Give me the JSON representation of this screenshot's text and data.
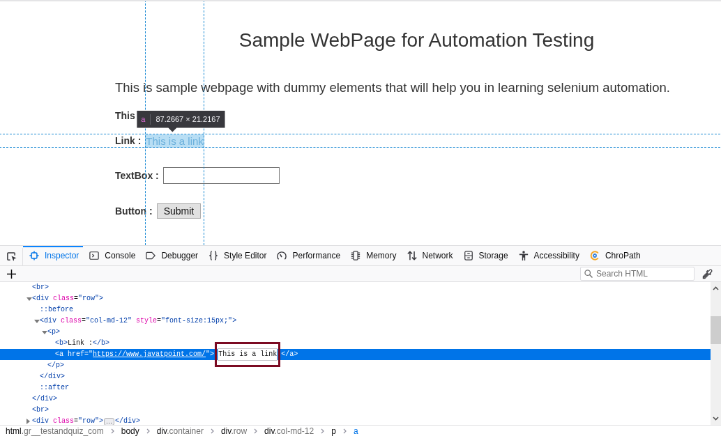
{
  "page": {
    "title": "Sample WebPage for Automation Testing",
    "intro": "This is sample webpage with dummy elements that will help you in learning selenium automation.",
    "rows": [
      {
        "kind": "text",
        "label": "This"
      },
      {
        "kind": "link",
        "label": "Link :",
        "link": "This is a link",
        "highlighted": true,
        "infobar": {
          "tag": "a",
          "size": "87.2667 × 21.2167"
        }
      },
      {
        "kind": "textbox",
        "label": "TextBox :"
      },
      {
        "kind": "button",
        "label": "Button :",
        "button": "Submit"
      }
    ]
  },
  "devtools": {
    "tabs": [
      {
        "label": "Inspector",
        "selected": true
      },
      {
        "label": "Console",
        "selected": false
      },
      {
        "label": "Debugger",
        "selected": false
      },
      {
        "label": "Style Editor",
        "selected": false
      },
      {
        "label": "Performance",
        "selected": false
      },
      {
        "label": "Memory",
        "selected": false
      },
      {
        "label": "Network",
        "selected": false
      },
      {
        "label": "Storage",
        "selected": false
      },
      {
        "label": "Accessibility",
        "selected": false
      },
      {
        "label": "ChroPath",
        "selected": false
      }
    ],
    "search": {
      "placeholder": "Search HTML"
    },
    "markup": [
      {
        "kind": "leaf",
        "selected": false,
        "tokens": [
          {
            "kind": "tag",
            "text": "<br>"
          }
        ]
      },
      {
        "kind": "parent",
        "expanded": true,
        "selected": false,
        "tokens": [
          {
            "kind": "tag",
            "text": "<div"
          },
          {
            "kind": "attr",
            "text": " class"
          },
          {
            "kind": "punct",
            "text": "="
          },
          {
            "kind": "value",
            "text": "\"row\""
          },
          {
            "kind": "tag",
            "text": ">"
          }
        ],
        "children": [
          {
            "kind": "leaf",
            "selected": false,
            "tokens": [
              {
                "kind": "pseudo",
                "text": "::before"
              }
            ]
          },
          {
            "kind": "parent",
            "expanded": true,
            "selected": false,
            "tokens": [
              {
                "kind": "tag",
                "text": "<div"
              },
              {
                "kind": "attr",
                "text": " class"
              },
              {
                "kind": "punct",
                "text": "="
              },
              {
                "kind": "value",
                "text": "\"col-md-12\""
              },
              {
                "kind": "attr",
                "text": " style"
              },
              {
                "kind": "punct",
                "text": "="
              },
              {
                "kind": "value",
                "text": "\"font-size:15px;\""
              },
              {
                "kind": "tag",
                "text": ">"
              }
            ],
            "children": [
              {
                "kind": "parent",
                "expanded": true,
                "selected": false,
                "tokens": [
                  {
                    "kind": "tag",
                    "text": "<p>"
                  }
                ],
                "children": [
                  {
                    "kind": "leaf",
                    "selected": false,
                    "tokens": [
                      {
                        "kind": "tag",
                        "text": "<b>"
                      },
                      {
                        "kind": "text",
                        "text": "Link :"
                      },
                      {
                        "kind": "tag",
                        "text": "</b>"
                      }
                    ]
                  },
                  {
                    "kind": "leaf",
                    "selected": true,
                    "tokens": [
                      {
                        "kind": "tag",
                        "text": "<a"
                      },
                      {
                        "kind": "attr",
                        "text": " href"
                      },
                      {
                        "kind": "punct",
                        "text": "="
                      },
                      {
                        "kind": "value",
                        "text": "\""
                      },
                      {
                        "kind": "link",
                        "text": "https://www.javatpoint.com/"
                      },
                      {
                        "kind": "value",
                        "text": "\""
                      },
                      {
                        "kind": "tag",
                        "text": ">"
                      },
                      {
                        "kind": "highlight",
                        "text": "This is a link"
                      },
                      {
                        "kind": "tag",
                        "text": "</a>"
                      }
                    ]
                  }
                ],
                "close": [
                  {
                    "kind": "tag",
                    "text": "</p>"
                  }
                ]
              }
            ],
            "close": [
              {
                "kind": "tag",
                "text": "</div>"
              }
            ]
          },
          {
            "kind": "leaf",
            "selected": false,
            "tokens": [
              {
                "kind": "pseudo",
                "text": "::after"
              }
            ]
          }
        ],
        "close": [
          {
            "kind": "tag",
            "text": "</div>"
          }
        ]
      },
      {
        "kind": "leaf",
        "selected": false,
        "tokens": [
          {
            "kind": "tag",
            "text": "<br>"
          }
        ]
      },
      {
        "kind": "parent",
        "expanded": false,
        "selected": false,
        "tokens": [
          {
            "kind": "tag",
            "text": "<div"
          },
          {
            "kind": "attr",
            "text": " class"
          },
          {
            "kind": "punct",
            "text": "="
          },
          {
            "kind": "value",
            "text": "\"row\""
          },
          {
            "kind": "tag",
            "text": ">"
          },
          {
            "kind": "more",
            "text": "…"
          },
          {
            "kind": "tag",
            "text": "</div>"
          }
        ]
      }
    ],
    "breadcrumbs": [
      {
        "tag": "html",
        "classes": ".gr__testandquiz_com",
        "selected": false
      },
      {
        "tag": "body",
        "selected": false
      },
      {
        "tag": "div",
        "classes": ".container",
        "selected": false
      },
      {
        "tag": "div",
        "classes": ".row",
        "selected": false
      },
      {
        "tag": "div",
        "classes": ".col-md-12",
        "selected": false
      },
      {
        "tag": "p",
        "selected": false
      },
      {
        "tag": "a",
        "selected": true
      }
    ]
  }
}
